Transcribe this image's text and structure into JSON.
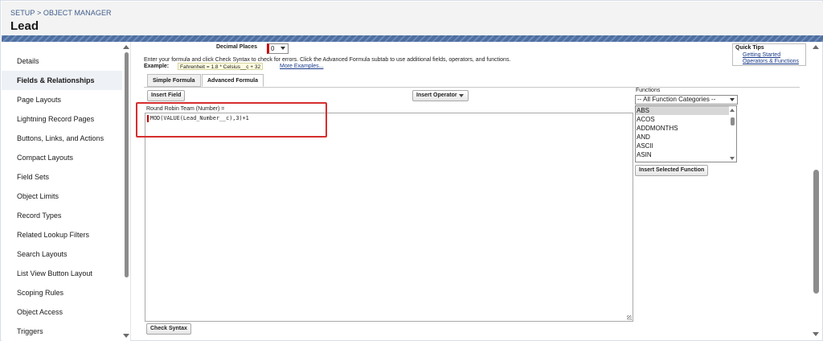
{
  "header": {
    "breadcrumb": "SETUP > OBJECT MANAGER",
    "title": "Lead"
  },
  "sidebar": {
    "items": [
      {
        "label": "Details",
        "active": false
      },
      {
        "label": "Fields & Relationships",
        "active": true
      },
      {
        "label": "Page Layouts",
        "active": false
      },
      {
        "label": "Lightning Record Pages",
        "active": false
      },
      {
        "label": "Buttons, Links, and Actions",
        "active": false
      },
      {
        "label": "Compact Layouts",
        "active": false
      },
      {
        "label": "Field Sets",
        "active": false
      },
      {
        "label": "Object Limits",
        "active": false
      },
      {
        "label": "Record Types",
        "active": false
      },
      {
        "label": "Related Lookup Filters",
        "active": false
      },
      {
        "label": "Search Layouts",
        "active": false
      },
      {
        "label": "List View Button Layout",
        "active": false
      },
      {
        "label": "Scoping Rules",
        "active": false
      },
      {
        "label": "Object Access",
        "active": false
      },
      {
        "label": "Triggers",
        "active": false
      }
    ]
  },
  "formula": {
    "decimal_places_label": "Decimal Places",
    "decimal_places_value": "0",
    "instructions": "Enter your formula and click Check Syntax to check for errors. Click the Advanced Formula subtab to use additional fields, operators, and functions.",
    "example_label": "Example:",
    "example_code": "Fahrenheit = 1.8 * Celsius__c + 32",
    "more_examples": "More Examples...",
    "tabs": [
      "Simple Formula",
      "Advanced Formula"
    ],
    "active_tab": "Advanced Formula",
    "insert_field": "Insert Field",
    "insert_operator": "Insert Operator",
    "field_label": "Round Robin Team (Number) =",
    "expression": "MOD(VALUE(Lead_Number__c),3)+1",
    "check_syntax": "Check Syntax"
  },
  "quick_tips": {
    "title": "Quick Tips",
    "links": [
      "Getting Started",
      "Operators & Functions"
    ]
  },
  "functions": {
    "label": "Functions",
    "category": "-- All Function Categories --",
    "items": [
      "ABS",
      "ACOS",
      "ADDMONTHS",
      "AND",
      "ASCII",
      "ASIN"
    ],
    "selected": "ABS",
    "insert_button": "Insert Selected Function"
  },
  "colors": {
    "accent_red": "#d62e2e",
    "link_blue": "#1a3a8a",
    "banner_blue": "#5878a8"
  }
}
